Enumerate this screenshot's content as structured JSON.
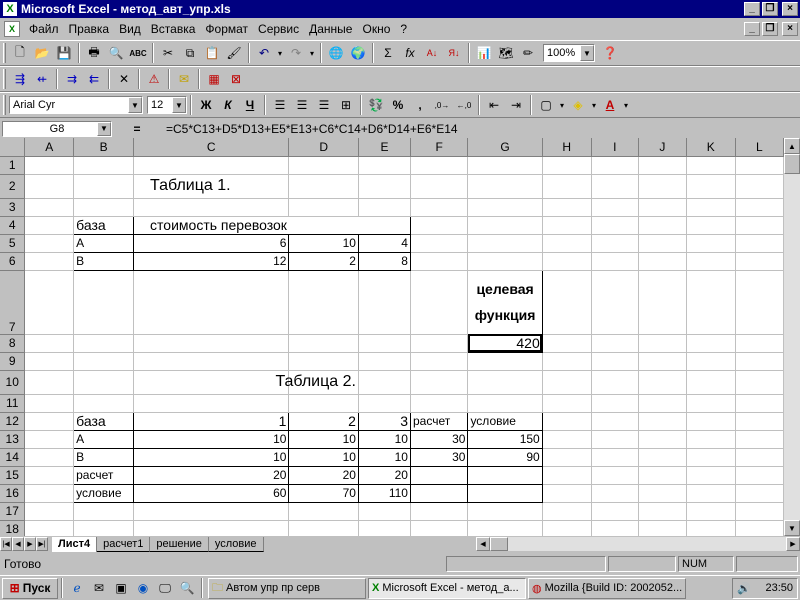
{
  "window": {
    "title": "Microsoft Excel - метод_авт_упр.xls",
    "minimize": "_",
    "restore": "❐",
    "close": "×"
  },
  "menu": [
    "Файл",
    "Правка",
    "Вид",
    "Вставка",
    "Формат",
    "Сервис",
    "Данные",
    "Окно",
    "?"
  ],
  "toolbar": {
    "zoom": "100%",
    "font_name": "Arial Cyr",
    "font_size": "12",
    "bold": "Ж",
    "italic": "К",
    "underline": "Ч",
    "percent": "%",
    "comma": ",",
    "increase_decimal": ",00 →,0",
    "sum": "Σ",
    "fx": "fx"
  },
  "formula_bar": {
    "cell_ref": "G8",
    "equals": "=",
    "formula": "=C5*C13+D5*D13+E5*E13+C6*C14+D6*D14+E6*E14"
  },
  "columns": [
    "A",
    "B",
    "C",
    "D",
    "E",
    "F",
    "G",
    "H",
    "I",
    "J",
    "K",
    "L"
  ],
  "rows": [
    "1",
    "2",
    "3",
    "4",
    "5",
    "6",
    "7",
    "8",
    "9",
    "10",
    "11",
    "12",
    "13",
    "14",
    "15",
    "16",
    "17",
    "18"
  ],
  "sheet": {
    "table1_title": "Таблица 1.",
    "table1_header_base": "база",
    "table1_header_cost": "стоимость перевозок",
    "t1": [
      [
        "А",
        "6",
        "10",
        "4"
      ],
      [
        "В",
        "12",
        "2",
        "8"
      ]
    ],
    "target_label_1": "целевая",
    "target_label_2": "функция",
    "target_value": "420",
    "table2_title": "Таблица 2.",
    "t2_header": [
      "база",
      "1",
      "2",
      "3",
      "расчет",
      "условие"
    ],
    "t2": [
      [
        "А",
        "10",
        "10",
        "10",
        "30",
        "150"
      ],
      [
        "В",
        "10",
        "10",
        "10",
        "30",
        "90"
      ],
      [
        "расчет",
        "20",
        "20",
        "20",
        "",
        ""
      ],
      [
        "условие",
        "60",
        "70",
        "110",
        "",
        ""
      ]
    ]
  },
  "tabs": [
    "Лист4",
    "расчет1",
    "решение",
    "условие"
  ],
  "status": {
    "ready": "Готово",
    "num": "NUM"
  },
  "taskbar": {
    "start": "Пуск",
    "tasks": [
      "Автом упр пр серв",
      "Microsoft Excel - метод_а...",
      "Mozilla {Build ID: 2002052..."
    ],
    "clock": "23:50"
  }
}
